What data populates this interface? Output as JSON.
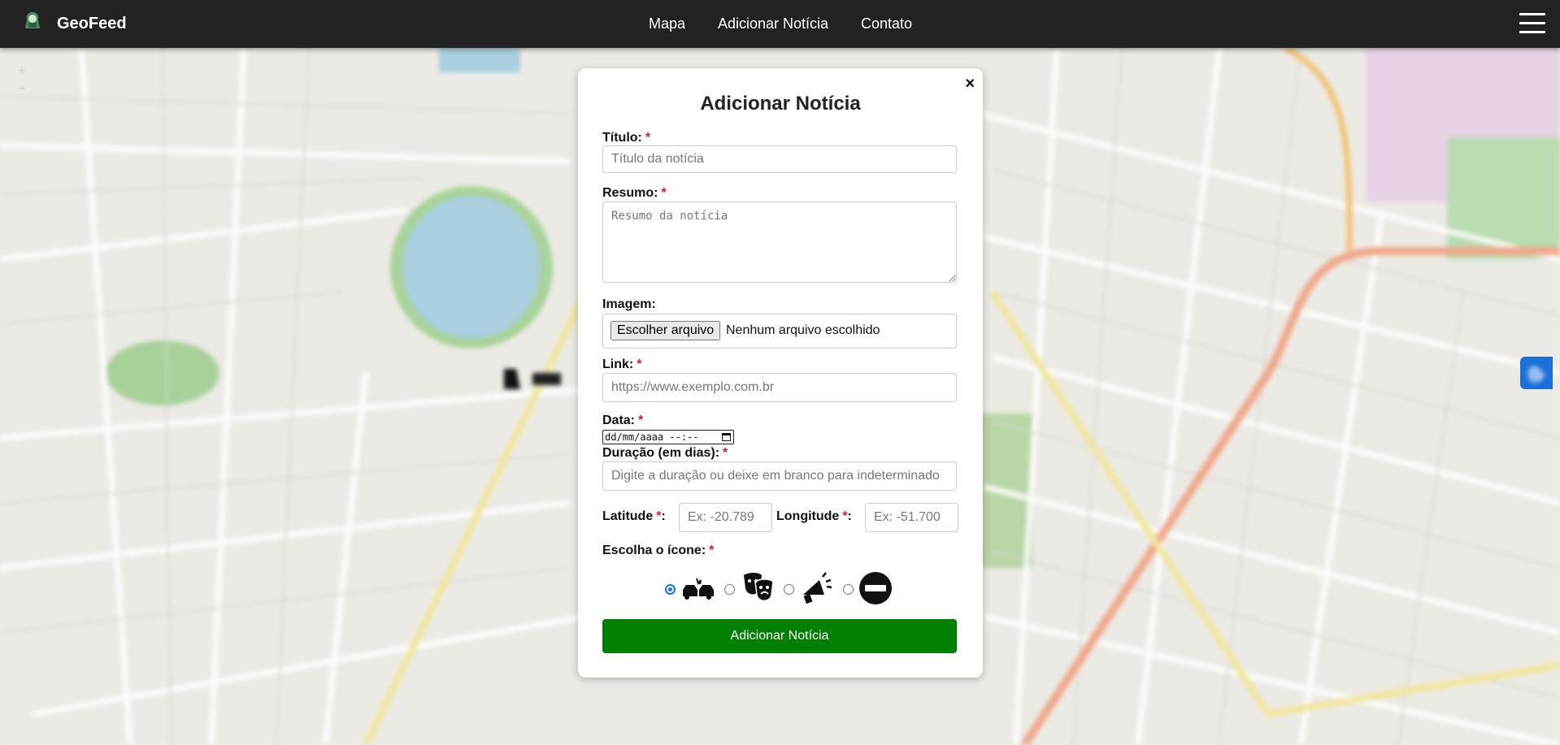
{
  "navbar": {
    "brand": "GeoFeed",
    "links": [
      "Mapa",
      "Adicionar Notícia",
      "Contato"
    ]
  },
  "map": {
    "zoom_in": "+",
    "zoom_out": "−"
  },
  "modal": {
    "title": "Adicionar Notícia",
    "close": "×",
    "titulo": {
      "label": "Título:",
      "placeholder": "Título da notícia"
    },
    "resumo": {
      "label": "Resumo:",
      "placeholder": "Resumo da notícia"
    },
    "imagem": {
      "label": "Imagem:",
      "button": "Escolher arquivo",
      "status": "Nenhum arquivo escolhido"
    },
    "link": {
      "label": "Link:",
      "placeholder": "https://www.exemplo.com.br"
    },
    "data": {
      "label": "Data:",
      "value": "dd/mm/aaaa --:--"
    },
    "duracao": {
      "label": "Duração (em dias):",
      "placeholder": "Digite a duração ou deixe em branco para indeterminado"
    },
    "latitude": {
      "label": "Latitude",
      "placeholder": "Ex: -20.789"
    },
    "longitude": {
      "label": "Longitude",
      "placeholder": "Ex: -51.700"
    },
    "icone": {
      "label": "Escolha o ícone:",
      "options": [
        "car-accident-icon",
        "theater-masks-icon",
        "megaphone-icon",
        "no-entry-icon"
      ],
      "selected": 0
    },
    "required_mark": "*",
    "submit": "Adicionar Notícia"
  },
  "colors": {
    "navbar": "#222222",
    "submit": "#008000",
    "required": "#e01b24",
    "accessibility": "#1b6fd9"
  }
}
